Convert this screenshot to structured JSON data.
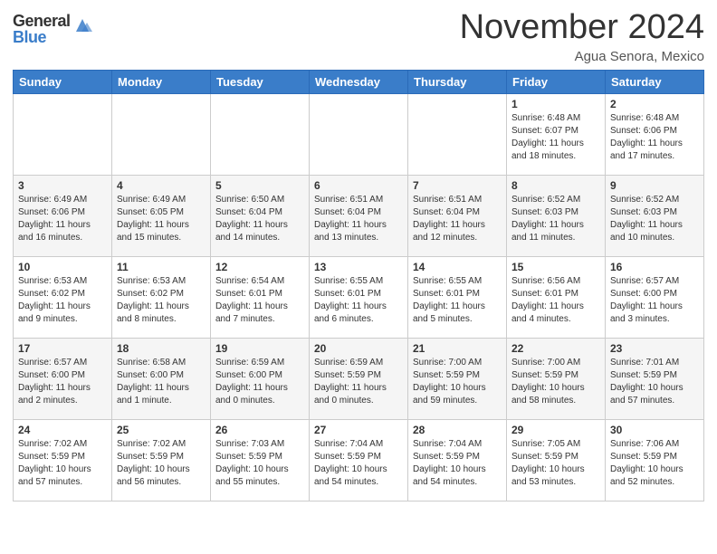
{
  "header": {
    "logo_general": "General",
    "logo_blue": "Blue",
    "month_title": "November 2024",
    "location": "Agua Senora, Mexico"
  },
  "weekdays": [
    "Sunday",
    "Monday",
    "Tuesday",
    "Wednesday",
    "Thursday",
    "Friday",
    "Saturday"
  ],
  "weeks": [
    [
      {
        "day": "",
        "info": ""
      },
      {
        "day": "",
        "info": ""
      },
      {
        "day": "",
        "info": ""
      },
      {
        "day": "",
        "info": ""
      },
      {
        "day": "",
        "info": ""
      },
      {
        "day": "1",
        "info": "Sunrise: 6:48 AM\nSunset: 6:07 PM\nDaylight: 11 hours\nand 18 minutes."
      },
      {
        "day": "2",
        "info": "Sunrise: 6:48 AM\nSunset: 6:06 PM\nDaylight: 11 hours\nand 17 minutes."
      }
    ],
    [
      {
        "day": "3",
        "info": "Sunrise: 6:49 AM\nSunset: 6:06 PM\nDaylight: 11 hours\nand 16 minutes."
      },
      {
        "day": "4",
        "info": "Sunrise: 6:49 AM\nSunset: 6:05 PM\nDaylight: 11 hours\nand 15 minutes."
      },
      {
        "day": "5",
        "info": "Sunrise: 6:50 AM\nSunset: 6:04 PM\nDaylight: 11 hours\nand 14 minutes."
      },
      {
        "day": "6",
        "info": "Sunrise: 6:51 AM\nSunset: 6:04 PM\nDaylight: 11 hours\nand 13 minutes."
      },
      {
        "day": "7",
        "info": "Sunrise: 6:51 AM\nSunset: 6:04 PM\nDaylight: 11 hours\nand 12 minutes."
      },
      {
        "day": "8",
        "info": "Sunrise: 6:52 AM\nSunset: 6:03 PM\nDaylight: 11 hours\nand 11 minutes."
      },
      {
        "day": "9",
        "info": "Sunrise: 6:52 AM\nSunset: 6:03 PM\nDaylight: 11 hours\nand 10 minutes."
      }
    ],
    [
      {
        "day": "10",
        "info": "Sunrise: 6:53 AM\nSunset: 6:02 PM\nDaylight: 11 hours\nand 9 minutes."
      },
      {
        "day": "11",
        "info": "Sunrise: 6:53 AM\nSunset: 6:02 PM\nDaylight: 11 hours\nand 8 minutes."
      },
      {
        "day": "12",
        "info": "Sunrise: 6:54 AM\nSunset: 6:01 PM\nDaylight: 11 hours\nand 7 minutes."
      },
      {
        "day": "13",
        "info": "Sunrise: 6:55 AM\nSunset: 6:01 PM\nDaylight: 11 hours\nand 6 minutes."
      },
      {
        "day": "14",
        "info": "Sunrise: 6:55 AM\nSunset: 6:01 PM\nDaylight: 11 hours\nand 5 minutes."
      },
      {
        "day": "15",
        "info": "Sunrise: 6:56 AM\nSunset: 6:01 PM\nDaylight: 11 hours\nand 4 minutes."
      },
      {
        "day": "16",
        "info": "Sunrise: 6:57 AM\nSunset: 6:00 PM\nDaylight: 11 hours\nand 3 minutes."
      }
    ],
    [
      {
        "day": "17",
        "info": "Sunrise: 6:57 AM\nSunset: 6:00 PM\nDaylight: 11 hours\nand 2 minutes."
      },
      {
        "day": "18",
        "info": "Sunrise: 6:58 AM\nSunset: 6:00 PM\nDaylight: 11 hours\nand 1 minute."
      },
      {
        "day": "19",
        "info": "Sunrise: 6:59 AM\nSunset: 6:00 PM\nDaylight: 11 hours\nand 0 minutes."
      },
      {
        "day": "20",
        "info": "Sunrise: 6:59 AM\nSunset: 5:59 PM\nDaylight: 11 hours\nand 0 minutes."
      },
      {
        "day": "21",
        "info": "Sunrise: 7:00 AM\nSunset: 5:59 PM\nDaylight: 10 hours\nand 59 minutes."
      },
      {
        "day": "22",
        "info": "Sunrise: 7:00 AM\nSunset: 5:59 PM\nDaylight: 10 hours\nand 58 minutes."
      },
      {
        "day": "23",
        "info": "Sunrise: 7:01 AM\nSunset: 5:59 PM\nDaylight: 10 hours\nand 57 minutes."
      }
    ],
    [
      {
        "day": "24",
        "info": "Sunrise: 7:02 AM\nSunset: 5:59 PM\nDaylight: 10 hours\nand 57 minutes."
      },
      {
        "day": "25",
        "info": "Sunrise: 7:02 AM\nSunset: 5:59 PM\nDaylight: 10 hours\nand 56 minutes."
      },
      {
        "day": "26",
        "info": "Sunrise: 7:03 AM\nSunset: 5:59 PM\nDaylight: 10 hours\nand 55 minutes."
      },
      {
        "day": "27",
        "info": "Sunrise: 7:04 AM\nSunset: 5:59 PM\nDaylight: 10 hours\nand 54 minutes."
      },
      {
        "day": "28",
        "info": "Sunrise: 7:04 AM\nSunset: 5:59 PM\nDaylight: 10 hours\nand 54 minutes."
      },
      {
        "day": "29",
        "info": "Sunrise: 7:05 AM\nSunset: 5:59 PM\nDaylight: 10 hours\nand 53 minutes."
      },
      {
        "day": "30",
        "info": "Sunrise: 7:06 AM\nSunset: 5:59 PM\nDaylight: 10 hours\nand 52 minutes."
      }
    ]
  ]
}
